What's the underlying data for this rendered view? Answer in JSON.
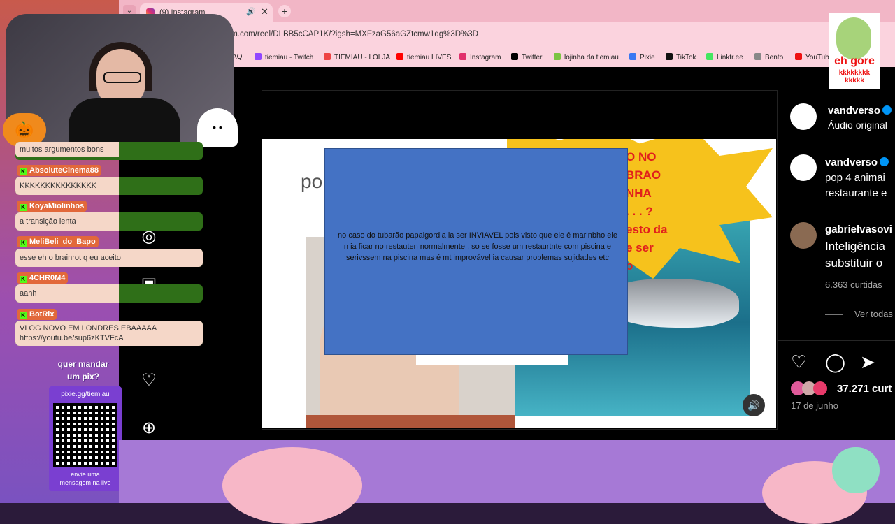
{
  "browser": {
    "tab_title": "(9) Instagram",
    "url": "ram.com/reel/DLBB5cCAP1K/?igsh=MXFzaG56aGZtcmw1dg%3D%3D",
    "bookmarks": [
      "AQ",
      "tiemiau - Twitch",
      "TIEMIAU - LOLJA",
      "tiemiau LIVES",
      "Instagram",
      "Twitter",
      "lojinha da tiemiau",
      "Pixie",
      "TikTok",
      "Linktr.ee",
      "Bento",
      "YouTub"
    ]
  },
  "slide": {
    "partial_title": "po",
    "burst_text": [
      "O NO",
      "BRAO",
      "NHA",
      ". . . ?",
      "esto da",
      "e ser",
      "o"
    ],
    "caption": "no caso do tubarão papaigordia ia ser INVIAVEL pois visto que ele é marinbho ele n ia ficar no restauten normalmente , so se fosse um restaurtnte com piscina e serivssem na piscina mas é mt improvável ia causar problemas sujidades etc"
  },
  "post": {
    "author": "vandverso",
    "audio": "Áudio original",
    "caption_author": "vandverso",
    "caption_line1": "pop 4 animai",
    "caption_line2": "restaurante e",
    "commenter": "gabrielvasovi",
    "comment_line1": "Inteligência",
    "comment_line2": "substituir o",
    "comment_likes": "6.363 curtidas",
    "view_all": "Ver todas",
    "likes": "37.271 curt",
    "date": "17 de junho"
  },
  "chat": [
    {
      "user": "",
      "msg": "muitos argumentos bons"
    },
    {
      "user": "AbsoluteCinema88",
      "msg": "KKKKKKKKKKKKKKK"
    },
    {
      "user": "KoyaMiolinhos",
      "msg": "a transição lenta"
    },
    {
      "user": "MeliBeli_do_Bapo",
      "msg": "esse eh o brainrot q eu aceito"
    },
    {
      "user": "4CHR0M4",
      "msg": "aahh"
    },
    {
      "user": "BotRix",
      "msg1": "VLOG NOVO EM LONDRES EBAAAAA",
      "msg2": "https://youtu.be/sup6zKTVFcA"
    }
  ],
  "pix": {
    "cta_line1": "quer mandar",
    "cta_line2": "um pix?",
    "url": "pixie.gg/tiemiau",
    "note_line1": "envie uma",
    "note_line2": "mensagem na live"
  },
  "sticker": {
    "line1": "eh gore",
    "line2": "kkkkkkkk",
    "line3": "kkkkk"
  }
}
